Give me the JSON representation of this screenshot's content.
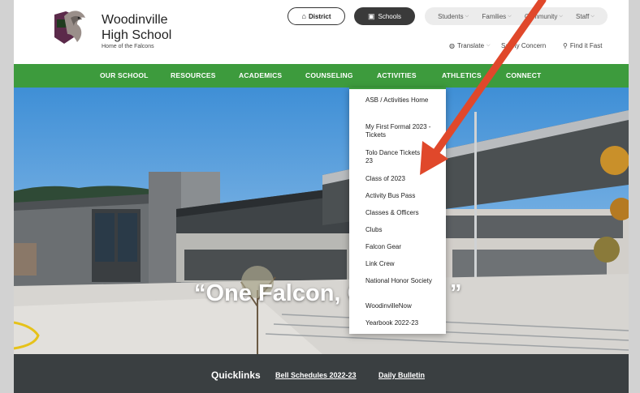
{
  "header": {
    "school_name_line1": "Woodinville",
    "school_name_line2": "High School",
    "tagline": "Home of the Falcons",
    "district_label": "District",
    "schools_label": "Schools",
    "menus": [
      "Students",
      "Families",
      "Community",
      "Staff"
    ],
    "utility": {
      "translate": "Translate",
      "safety": "Safety Concern",
      "find": "Find it Fast"
    }
  },
  "nav": {
    "items": [
      "OUR SCHOOL",
      "RESOURCES",
      "ACADEMICS",
      "COUNSELING",
      "ACTIVITIES",
      "ATHLETICS",
      "CONNECT"
    ]
  },
  "dropdown": {
    "items": [
      "ASB / Activities Home",
      "My First Formal 2023 - Tickets",
      "Tolo Dance Tickets 2022-23",
      "Class of 2023",
      "Activity Bus Pass",
      "Classes & Officers",
      "Clubs",
      "Falcon Gear",
      "Link Crew",
      "National Honor Society",
      "WoodinvilleNow",
      "Yearbook 2022-23"
    ]
  },
  "hero": {
    "quote_visible": "“One Falcon, O",
    "quote_end": "”"
  },
  "quicklinks": {
    "label": "Quicklinks",
    "links": [
      "Bell Schedules 2022-23",
      "Daily Bulletin"
    ]
  },
  "colors": {
    "nav_green": "#3d9b3d",
    "arrow_red": "#e0482b",
    "quicklinks_bg": "#3a3f41"
  }
}
